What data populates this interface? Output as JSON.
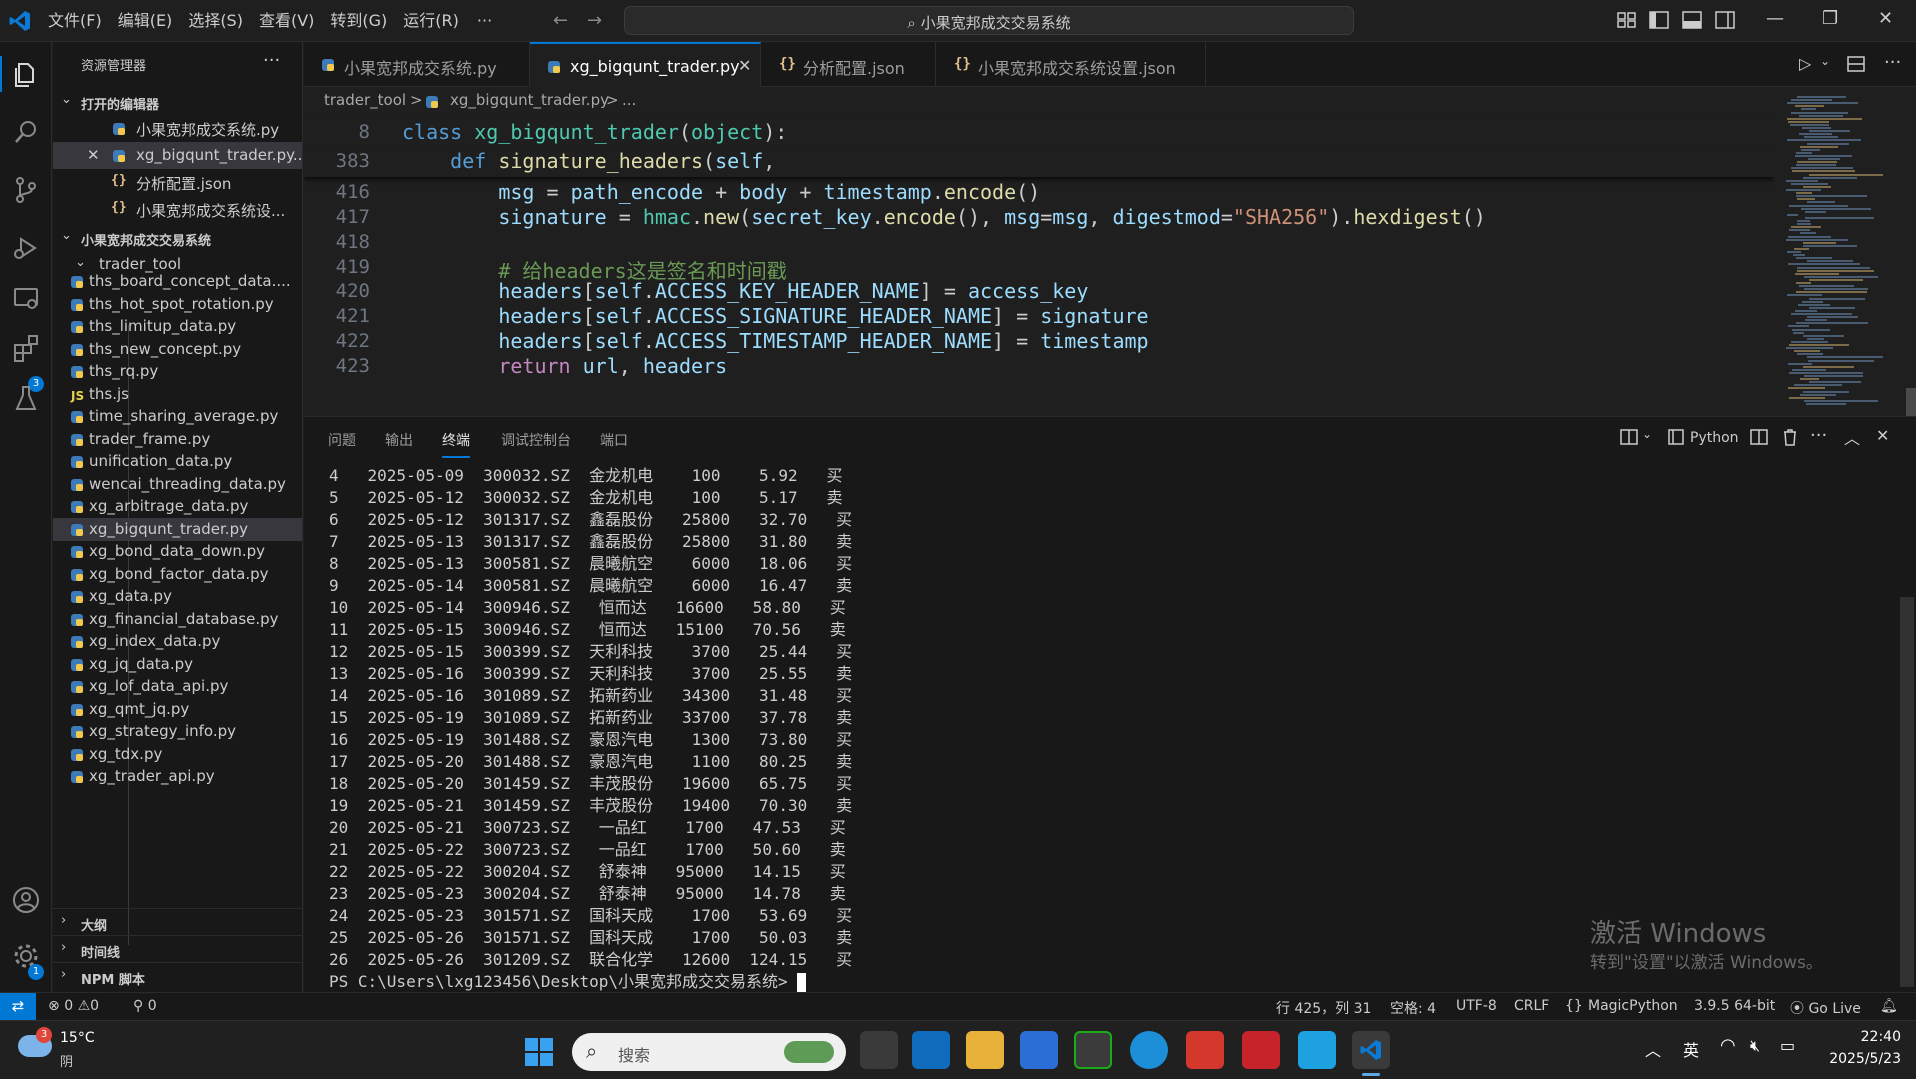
{
  "menu": {
    "items": [
      "文件(F)",
      "编辑(E)",
      "选择(S)",
      "查看(V)",
      "转到(G)",
      "运行(R)",
      "···"
    ]
  },
  "command_center": {
    "text": "小果宽邦成交交易系统"
  },
  "sidebar": {
    "title": "资源管理器",
    "more": "···",
    "open_editors_title": "打开的编辑器",
    "open_editors": [
      {
        "name": "小果宽邦成交系统.py",
        "icon": "python-file-icon"
      },
      {
        "name": "xg_bigqunt_trader.py...",
        "icon": "python-file-icon",
        "close": "✕"
      },
      {
        "name": "分析配置.json",
        "icon": "json-file-icon"
      },
      {
        "name": "小果宽邦成交系统设...",
        "icon": "json-file-icon"
      }
    ],
    "project_title": "小果宽邦成交交易系统",
    "folder": "trader_tool",
    "files": [
      "ths_board_concept_data....",
      "ths_hot_spot_rotation.py",
      "ths_limitup_data.py",
      "ths_new_concept.py",
      "ths_rq.py",
      "ths.js",
      "time_sharing_average.py",
      "trader_frame.py",
      "unification_data.py",
      "wencai_threading_data.py",
      "xg_arbitrage_data.py",
      "xg_bigqunt_trader.py",
      "xg_bond_data_down.py",
      "xg_bond_factor_data.py",
      "xg_data.py",
      "xg_financial_database.py",
      "xg_index_data.py",
      "xg_jq_data.py",
      "xg_lof_data_api.py",
      "xg_qmt_jq.py",
      "xg_strategy_info.py",
      "xg_tdx.py",
      "xg_trader_api.py"
    ],
    "outline": "大纲",
    "timeline": "时间线",
    "npm": "NPM 脚本",
    "js_label": "JS"
  },
  "tabs": [
    {
      "label": "小果宽邦成交系统.py",
      "icon": "python-file-icon"
    },
    {
      "label": "xg_bigqunt_trader.py",
      "icon": "python-file-icon",
      "active": true,
      "close": "✕"
    },
    {
      "label": "分析配置.json",
      "icon": "json-file-icon"
    },
    {
      "label": "小果宽邦成交系统设置.json",
      "icon": "json-file-icon"
    }
  ],
  "breadcrumb": {
    "folder": "trader_tool",
    "file": "xg_bigqunt_trader.py",
    "tail": "...",
    "sep": ">"
  },
  "editor": {
    "lines": [
      {
        "n": "8",
        "tokens": [
          [
            "kw",
            "class "
          ],
          [
            "cls",
            "xg_bigqunt_trader"
          ],
          [
            "p",
            "("
          ],
          [
            "cls",
            "object"
          ],
          [
            "p",
            "):"
          ]
        ]
      },
      {
        "n": "383",
        "tokens": [
          [
            "p",
            "    "
          ],
          [
            "kw",
            "def "
          ],
          [
            "fn",
            "signature_headers"
          ],
          [
            "p",
            "("
          ],
          [
            "var",
            "self"
          ],
          [
            "p",
            ","
          ]
        ]
      },
      {
        "n": "416",
        "tokens": [
          [
            "p",
            "        "
          ],
          [
            "var",
            "msg"
          ],
          [
            "p",
            " = "
          ],
          [
            "var",
            "path_encode"
          ],
          [
            "p",
            " + "
          ],
          [
            "var",
            "body"
          ],
          [
            "p",
            " + "
          ],
          [
            "var",
            "timestamp"
          ],
          [
            "p",
            "."
          ],
          [
            "fn",
            "encode"
          ],
          [
            "p",
            "()"
          ]
        ]
      },
      {
        "n": "417",
        "tokens": [
          [
            "p",
            "        "
          ],
          [
            "var",
            "signature"
          ],
          [
            "p",
            " = "
          ],
          [
            "cls",
            "hmac"
          ],
          [
            "p",
            "."
          ],
          [
            "fn",
            "new"
          ],
          [
            "p",
            "("
          ],
          [
            "var",
            "secret_key"
          ],
          [
            "p",
            "."
          ],
          [
            "fn",
            "encode"
          ],
          [
            "p",
            "(), "
          ],
          [
            "var",
            "msg"
          ],
          [
            "p",
            "="
          ],
          [
            "var",
            "msg"
          ],
          [
            "p",
            ", "
          ],
          [
            "var",
            "digestmod"
          ],
          [
            "p",
            "="
          ],
          [
            "str",
            "\"SHA256\""
          ],
          [
            "p",
            ")."
          ],
          [
            "fn",
            "hexdigest"
          ],
          [
            "p",
            "()"
          ]
        ]
      },
      {
        "n": "418",
        "tokens": []
      },
      {
        "n": "419",
        "tokens": [
          [
            "p",
            "        "
          ],
          [
            "cmt",
            "# 给headers这是签名和时间戳"
          ]
        ]
      },
      {
        "n": "420",
        "tokens": [
          [
            "p",
            "        "
          ],
          [
            "var",
            "headers"
          ],
          [
            "p",
            "["
          ],
          [
            "var",
            "self"
          ],
          [
            "p",
            "."
          ],
          [
            "var",
            "ACCESS_KEY_HEADER_NAME"
          ],
          [
            "p",
            "] = "
          ],
          [
            "var",
            "access_key"
          ]
        ]
      },
      {
        "n": "421",
        "tokens": [
          [
            "p",
            "        "
          ],
          [
            "var",
            "headers"
          ],
          [
            "p",
            "["
          ],
          [
            "var",
            "self"
          ],
          [
            "p",
            "."
          ],
          [
            "var",
            "ACCESS_SIGNATURE_HEADER_NAME"
          ],
          [
            "p",
            "] = "
          ],
          [
            "var",
            "signature"
          ]
        ]
      },
      {
        "n": "422",
        "tokens": [
          [
            "p",
            "        "
          ],
          [
            "var",
            "headers"
          ],
          [
            "p",
            "["
          ],
          [
            "var",
            "self"
          ],
          [
            "p",
            "."
          ],
          [
            "var",
            "ACCESS_TIMESTAMP_HEADER_NAME"
          ],
          [
            "p",
            "] = "
          ],
          [
            "var",
            "timestamp"
          ]
        ]
      },
      {
        "n": "423",
        "tokens": [
          [
            "p",
            "        "
          ],
          [
            "kw2",
            "return "
          ],
          [
            "var",
            "url"
          ],
          [
            "p",
            ", "
          ],
          [
            "var",
            "headers"
          ]
        ]
      }
    ]
  },
  "panel": {
    "tabs": [
      "问题",
      "输出",
      "终端",
      "调试控制台",
      "端口"
    ],
    "active_tab": "终端",
    "terminal_type": "Python",
    "terminal_lines": [
      "4   2025-05-09  300032.SZ  金龙机电    100    5.92   买",
      "5   2025-05-12  300032.SZ  金龙机电    100    5.17   卖",
      "6   2025-05-12  301317.SZ  鑫磊股份   25800   32.70   买",
      "7   2025-05-13  301317.SZ  鑫磊股份   25800   31.80   卖",
      "8   2025-05-13  300581.SZ  晨曦航空    6000   18.06   买",
      "9   2025-05-14  300581.SZ  晨曦航空    6000   16.47   卖",
      "10  2025-05-14  300946.SZ   恒而达   16600   58.80   买",
      "11  2025-05-15  300946.SZ   恒而达   15100   70.56   卖",
      "12  2025-05-15  300399.SZ  天利科技    3700   25.44   买",
      "13  2025-05-16  300399.SZ  天利科技    3700   25.55   卖",
      "14  2025-05-16  301089.SZ  拓新药业   34300   31.48   买",
      "15  2025-05-19  301089.SZ  拓新药业   33700   37.78   卖",
      "16  2025-05-19  301488.SZ  豪恩汽电    1300   73.80   买",
      "17  2025-05-20  301488.SZ  豪恩汽电    1100   80.25   卖",
      "18  2025-05-20  301459.SZ  丰茂股份   19600   65.75   买",
      "19  2025-05-21  301459.SZ  丰茂股份   19400   70.30   卖",
      "20  2025-05-21  300723.SZ   一品红    1700   47.53   买",
      "21  2025-05-22  300723.SZ   一品红    1700   50.60   卖",
      "22  2025-05-22  300204.SZ   舒泰神   95000   14.15   买",
      "23  2025-05-23  300204.SZ   舒泰神   95000   14.78   卖",
      "24  2025-05-23  301571.SZ  国科天成    1700   53.69   买",
      "25  2025-05-26  301571.SZ  国科天成    1700   50.03   卖",
      "26  2025-05-26  301209.SZ  联合化学   12600  124.15   买"
    ],
    "prompt": "PS C:\\Users\\lxg123456\\Desktop\\小果宽邦成交交易系统> ",
    "watermark_title": "激活 Windows",
    "watermark_sub": "转到\"设置\"以激活 Windows。"
  },
  "statusbar": {
    "errors": "0",
    "warnings": "0",
    "ports": "0",
    "position": "行 425，列 31",
    "spaces": "空格: 4",
    "encoding": "UTF-8",
    "eol": "CRLF",
    "language_icon": "{}",
    "language": "MagicPython",
    "interpreter": "3.9.5 64-bit",
    "golive": "Go Live"
  },
  "taskbar": {
    "weather_temp": "15°C",
    "weather_desc": "阴",
    "weather_badge": "3",
    "search_placeholder": "搜索",
    "ime": "英",
    "time": "22:40",
    "date": "2025/5/23"
  },
  "badges": {
    "extensions": "3",
    "accounts": "1"
  },
  "colors": {
    "accent": "#0078d4",
    "editor_bg": "#1f1f1f",
    "sidebar_bg": "#181818"
  }
}
